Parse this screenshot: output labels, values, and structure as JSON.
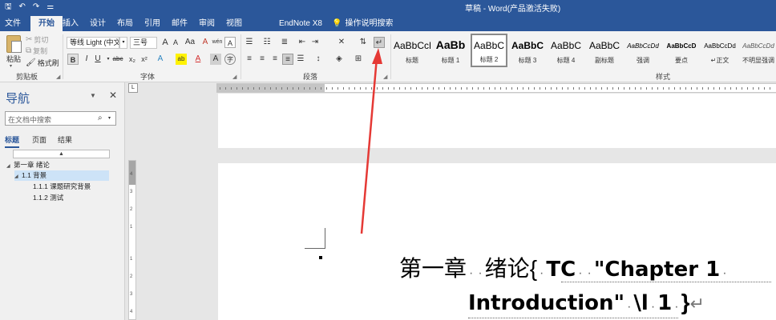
{
  "titlebar": {
    "title": "草稿 - Word(产品激活失败)",
    "quick_access": {
      "save": "🖫",
      "undo": "↶",
      "redo": "↷",
      "customize": "⚌"
    }
  },
  "tabs": [
    {
      "label": "文件"
    },
    {
      "label": "开始",
      "active": true
    },
    {
      "label": "插入"
    },
    {
      "label": "设计"
    },
    {
      "label": "布局"
    },
    {
      "label": "引用"
    },
    {
      "label": "邮件"
    },
    {
      "label": "审阅"
    },
    {
      "label": "视图"
    },
    {
      "label": "EndNote X8"
    },
    {
      "label": "操作说明搜索"
    }
  ],
  "ribbon": {
    "clipboard": {
      "paste": "粘贴",
      "cut": "剪切",
      "copy": "复制",
      "format_painter": "格式刷",
      "label": "剪贴板"
    },
    "font": {
      "font_name": "等线 Light (中文)",
      "font_size": "三号",
      "grow": "A",
      "shrink": "A",
      "case": "Aa",
      "clear": "A",
      "phonetic": "wén",
      "border_char": "A",
      "bold": "B",
      "italic": "I",
      "underline": "U",
      "strike": "abc",
      "subscript": "x₂",
      "superscript": "x²",
      "effects": "A",
      "highlight": "ab",
      "font_color": "A",
      "shading_char": "A",
      "enclose": "字",
      "label": "字体"
    },
    "paragraph": {
      "label": "段落"
    },
    "styles": {
      "label": "样式",
      "items": [
        {
          "preview": "AaBbCcDd",
          "name": "标题"
        },
        {
          "preview": "AaBb",
          "name": "标题 1"
        },
        {
          "preview": "AaBbC",
          "name": "标题 2",
          "selected": true
        },
        {
          "preview": "AaBbC",
          "name": "标题 3"
        },
        {
          "preview": "AaBbC",
          "name": "标题 4"
        },
        {
          "preview": "AaBbC",
          "name": "副标题"
        },
        {
          "preview": "AaBbCcDd",
          "name": "强调"
        },
        {
          "preview": "AaBbCcD",
          "name": "要点"
        },
        {
          "preview": "AaBbCcDd",
          "name": "正文"
        },
        {
          "preview": "AaBbCcDd",
          "name": "不明显强调"
        }
      ]
    }
  },
  "nav": {
    "title": "导航",
    "search_placeholder": "在文档中搜索",
    "tabs": [
      "标题",
      "页面",
      "结果"
    ],
    "collapse_symbol": "▲",
    "tree": [
      {
        "label": "第一章 绪论",
        "level": 0,
        "expanded": true
      },
      {
        "label": "1.1 背景",
        "level": 1,
        "expanded": true,
        "selected": true
      },
      {
        "label": "1.1.1 课题研究背景",
        "level": 2
      },
      {
        "label": "1.1.2 测试",
        "level": 2
      }
    ]
  },
  "ruler": {
    "tab_selector": "L",
    "vertical_numbers": [
      "4",
      "3",
      "2",
      "1",
      "1",
      "2",
      "3",
      "4",
      "5"
    ]
  },
  "document": {
    "line1": {
      "chapter": "第一章",
      "title": "绪论",
      "field_open": "{",
      "field_code": "TC",
      "field_text": "\"Chapter 1"
    },
    "line2": {
      "field_text": "Introduction\"",
      "switch": "\\l",
      "level": "1",
      "field_close": "}",
      "return_mark": "↵"
    }
  },
  "colors": {
    "brand": "#2b579a",
    "arrow": "#e53935",
    "nav_selected": "#cde3f7"
  }
}
